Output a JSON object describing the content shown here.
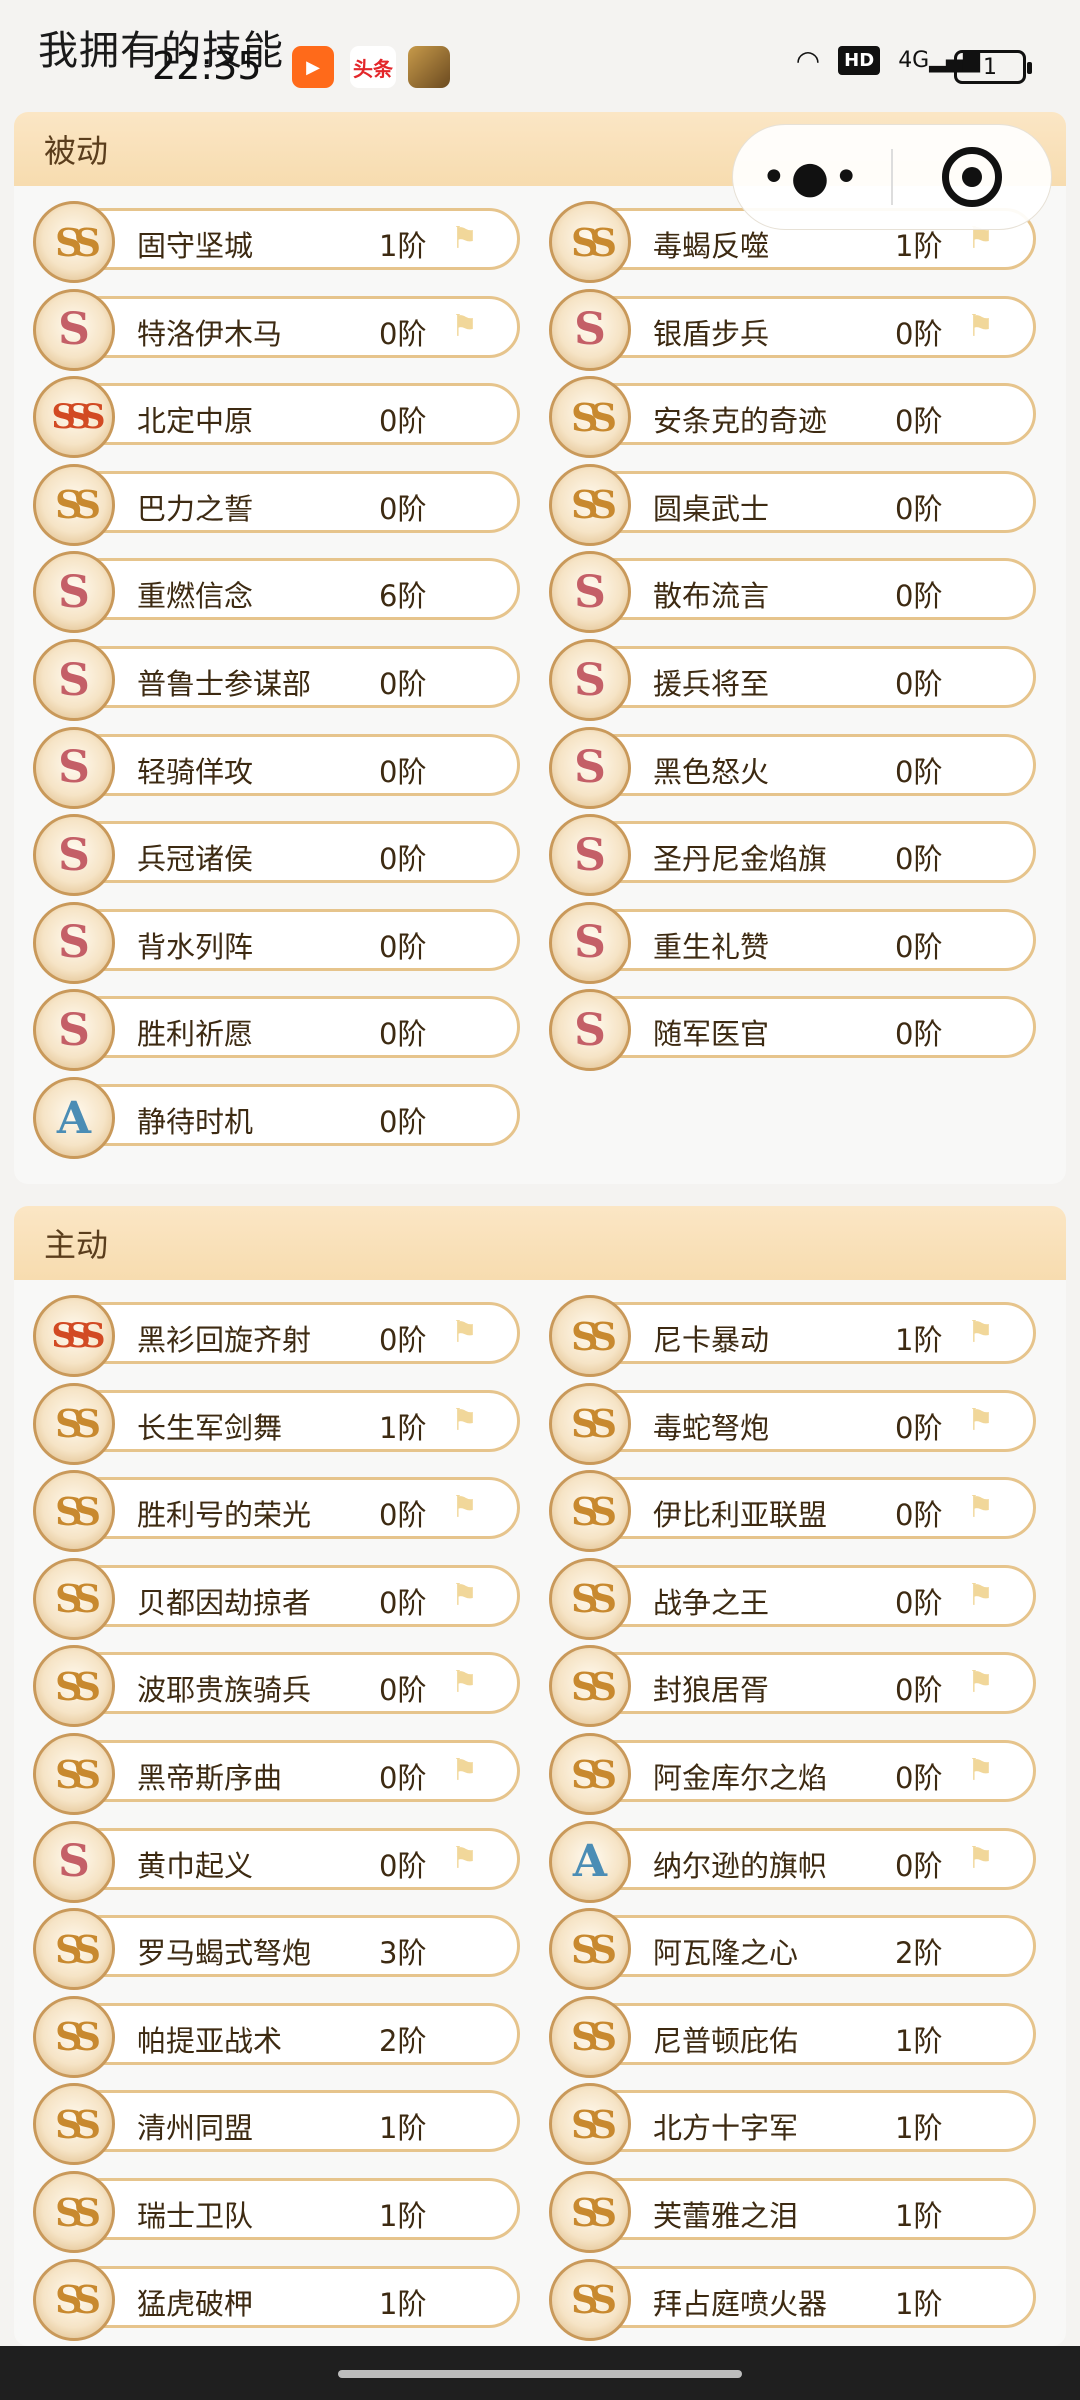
{
  "status": {
    "page_title": "我拥有的技能",
    "time": "22:35",
    "app_icons": [
      "kuaishou-icon",
      "toutiao-icon",
      "game-icon"
    ],
    "toutiao_label": "头条",
    "hd": "HD",
    "network": "4G",
    "battery": "1"
  },
  "capsule": {
    "more": "•●•"
  },
  "sections": [
    {
      "title": "被动",
      "skills": [
        {
          "name": "固守坚城",
          "level": "1阶",
          "rank": "SS",
          "flag": true
        },
        {
          "name": "毒蝎反噬",
          "level": "1阶",
          "rank": "SS",
          "flag": true
        },
        {
          "name": "特洛伊木马",
          "level": "0阶",
          "rank": "S",
          "flag": true
        },
        {
          "name": "银盾步兵",
          "level": "0阶",
          "rank": "S",
          "flag": true
        },
        {
          "name": "北定中原",
          "level": "0阶",
          "rank": "SSS",
          "flag": false
        },
        {
          "name": "安条克的奇迹",
          "level": "0阶",
          "rank": "SS",
          "flag": false
        },
        {
          "name": "巴力之誓",
          "level": "0阶",
          "rank": "SS",
          "flag": false
        },
        {
          "name": "圆桌武士",
          "level": "0阶",
          "rank": "SS",
          "flag": false
        },
        {
          "name": "重燃信念",
          "level": "6阶",
          "rank": "S",
          "flag": false
        },
        {
          "name": "散布流言",
          "level": "0阶",
          "rank": "S",
          "flag": false
        },
        {
          "name": "普鲁士参谋部",
          "level": "0阶",
          "rank": "S",
          "flag": false
        },
        {
          "name": "援兵将至",
          "level": "0阶",
          "rank": "S",
          "flag": false
        },
        {
          "name": "轻骑佯攻",
          "level": "0阶",
          "rank": "S",
          "flag": false
        },
        {
          "name": "黑色怒火",
          "level": "0阶",
          "rank": "S",
          "flag": false
        },
        {
          "name": "兵冠诸侯",
          "level": "0阶",
          "rank": "S",
          "flag": false
        },
        {
          "name": "圣丹尼金焰旗",
          "level": "0阶",
          "rank": "S",
          "flag": false
        },
        {
          "name": "背水列阵",
          "level": "0阶",
          "rank": "S",
          "flag": false
        },
        {
          "name": "重生礼赞",
          "level": "0阶",
          "rank": "S",
          "flag": false
        },
        {
          "name": "胜利祈愿",
          "level": "0阶",
          "rank": "S",
          "flag": false
        },
        {
          "name": "随军医官",
          "level": "0阶",
          "rank": "S",
          "flag": false
        },
        {
          "name": "静待时机",
          "level": "0阶",
          "rank": "A",
          "flag": false
        }
      ]
    },
    {
      "title": "主动",
      "skills": [
        {
          "name": "黑衫回旋齐射",
          "level": "0阶",
          "rank": "SSS",
          "flag": true
        },
        {
          "name": "尼卡暴动",
          "level": "1阶",
          "rank": "SS",
          "flag": true
        },
        {
          "name": "长生军剑舞",
          "level": "1阶",
          "rank": "SS",
          "flag": true
        },
        {
          "name": "毒蛇弩炮",
          "level": "0阶",
          "rank": "SS",
          "flag": true
        },
        {
          "name": "胜利号的荣光",
          "level": "0阶",
          "rank": "SS",
          "flag": true
        },
        {
          "name": "伊比利亚联盟",
          "level": "0阶",
          "rank": "SS",
          "flag": true
        },
        {
          "name": "贝都因劫掠者",
          "level": "0阶",
          "rank": "SS",
          "flag": true
        },
        {
          "name": "战争之王",
          "level": "0阶",
          "rank": "SS",
          "flag": true
        },
        {
          "name": "波耶贵族骑兵",
          "level": "0阶",
          "rank": "SS",
          "flag": true
        },
        {
          "name": "封狼居胥",
          "level": "0阶",
          "rank": "SS",
          "flag": true
        },
        {
          "name": "黑帝斯序曲",
          "level": "0阶",
          "rank": "SS",
          "flag": true
        },
        {
          "name": "阿金库尔之焰",
          "level": "0阶",
          "rank": "SS",
          "flag": true
        },
        {
          "name": "黄巾起义",
          "level": "0阶",
          "rank": "S",
          "flag": true
        },
        {
          "name": "纳尔逊的旗帜",
          "level": "0阶",
          "rank": "A",
          "flag": true
        },
        {
          "name": "罗马蝎式弩炮",
          "level": "3阶",
          "rank": "SS",
          "flag": false
        },
        {
          "name": "阿瓦隆之心",
          "level": "2阶",
          "rank": "SS",
          "flag": false
        },
        {
          "name": "帕提亚战术",
          "level": "2阶",
          "rank": "SS",
          "flag": false
        },
        {
          "name": "尼普顿庇佑",
          "level": "1阶",
          "rank": "SS",
          "flag": false
        },
        {
          "name": "清州同盟",
          "level": "1阶",
          "rank": "SS",
          "flag": false
        },
        {
          "name": "北方十字军",
          "level": "1阶",
          "rank": "SS",
          "flag": false
        },
        {
          "name": "瑞士卫队",
          "level": "1阶",
          "rank": "SS",
          "flag": false
        },
        {
          "name": "芙蕾雅之泪",
          "level": "1阶",
          "rank": "SS",
          "flag": false
        },
        {
          "name": "猛虎破柙",
          "level": "1阶",
          "rank": "SS",
          "flag": false
        },
        {
          "name": "拜占庭喷火器",
          "level": "1阶",
          "rank": "SS",
          "flag": false
        }
      ]
    }
  ],
  "flag_glyph": "⚑"
}
